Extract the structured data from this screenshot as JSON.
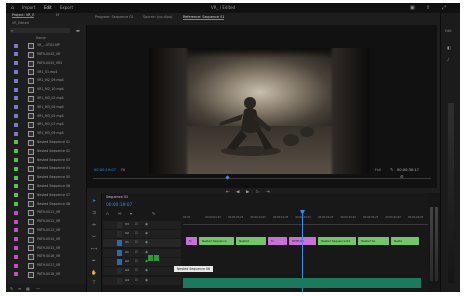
{
  "app": {
    "nav": [
      "Import",
      "Edit",
      "Export"
    ],
    "title": "VR_ / Edited"
  },
  "project_panel": {
    "tabs": [
      "Project: VR_E",
      "Ef"
    ],
    "subtitle": "VR_Edited",
    "header": "Name",
    "items": [
      {
        "label": "VR_...0T01.MP",
        "color": "#7a7ac8"
      },
      {
        "label": "PATH-0043_VR",
        "color": "#7a7ac8"
      },
      {
        "label": "PATH-0043_VR2",
        "color": "#7a7ac8"
      },
      {
        "label": "VR1_01.mp4",
        "color": "#7a7ac8"
      },
      {
        "label": "VR1_M2_09.mp4",
        "color": "#7a7ac8"
      },
      {
        "label": "VR1_M2_10.mp4",
        "color": "#7a7ac8"
      },
      {
        "label": "VR1_M3_02.mp4",
        "color": "#7a7ac8"
      },
      {
        "label": "VR1_M3_04.mp4",
        "color": "#7a7ac8"
      },
      {
        "label": "VR1_M3_05.mp4",
        "color": "#7a7ac8"
      },
      {
        "label": "VR1_M3_07.mp4",
        "color": "#7a7ac8"
      },
      {
        "label": "VR1_M3_09.mp4",
        "color": "#7a7ac8"
      },
      {
        "label": "Nested Sequence 01",
        "color": "#55c255"
      },
      {
        "label": "Nested Sequence 02",
        "color": "#55c255"
      },
      {
        "label": "Nested Sequence 03",
        "color": "#55c255"
      },
      {
        "label": "Nested Sequence 04",
        "color": "#55c255"
      },
      {
        "label": "Nested Sequence 05",
        "color": "#55c255"
      },
      {
        "label": "Nested Sequence 06",
        "color": "#55c255"
      },
      {
        "label": "Nested Sequence 07",
        "color": "#55c255"
      },
      {
        "label": "Nested Sequence 08",
        "color": "#55c255"
      },
      {
        "label": "PATH-0011_VR",
        "color": "#c04ec0"
      },
      {
        "label": "PATH-0012_VR",
        "color": "#c04ec0"
      },
      {
        "label": "PATH-0013_VR",
        "color": "#c04ec0"
      },
      {
        "label": "PATH-0014_VR",
        "color": "#c04ec0"
      },
      {
        "label": "PATH-0015_VR",
        "color": "#c04ec0"
      },
      {
        "label": "PATH-0016_VR",
        "color": "#c04ec0"
      },
      {
        "label": "PATH-0017_VR",
        "color": "#c04ec0"
      },
      {
        "label": "PATH-0018_VR",
        "color": "#c04ec0"
      }
    ]
  },
  "program_monitor": {
    "tabs": [
      "Program: Sequence 01",
      "Source: (no clips)",
      "Reference: Sequence 01"
    ],
    "timecode_left": "00:00:19:07",
    "fit": "Fit",
    "scale": "Full",
    "timecode_right": "00:00:30:17"
  },
  "timeline": {
    "tab": "Sequence 01",
    "timecode": "00:00:19:07",
    "ruler": [
      "00:00",
      "00:00:04:23",
      "00:00:09:23",
      "00:00:14:23",
      "00:00:19:23",
      "00:00:24:23",
      "00:00:29:23",
      "00:00:34:23",
      "00:00:39:23",
      "00:00:44:23",
      "00:00:49:23"
    ],
    "video_clips": [
      {
        "label": "fx",
        "color": "#c96fd8"
      },
      {
        "label": "Nested Sequence",
        "color": "#74c46a"
      },
      {
        "label": "Nested",
        "color": "#74c46a"
      },
      {
        "label": "fx",
        "color": "#c96fd8"
      },
      {
        "label": "PATH-00",
        "color": "#c96fd8"
      },
      {
        "label": "Nested Sequence 04",
        "color": "#74c46a"
      },
      {
        "label": "Nested Se",
        "color": "#74c46a"
      },
      {
        "label": "Neste",
        "color": "#74c46a"
      }
    ],
    "tooltip": "Nested Sequence 08",
    "track_labels": [
      "V3",
      "V2",
      "V1",
      "A1",
      "A2",
      "A3",
      "A4"
    ]
  },
  "right_strip": {
    "label": "Edit"
  }
}
